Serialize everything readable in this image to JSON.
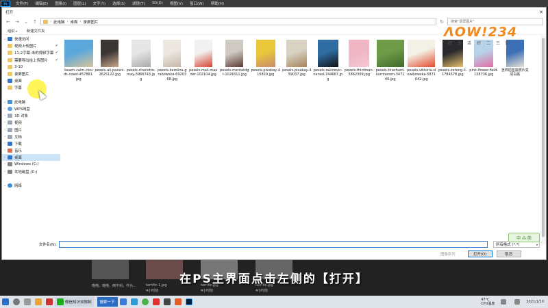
{
  "ps_menu": {
    "logo": "Ps",
    "items": [
      "文件(F)",
      "编辑(E)",
      "图像(I)",
      "图层(L)",
      "文字(Y)",
      "选择(S)",
      "滤镜(T)",
      "3D(D)",
      "视图(V)",
      "窗口(W)",
      "帮助(H)"
    ]
  },
  "dialog": {
    "title": "打开",
    "close": "✕",
    "breadcrumb": [
      "此电脑",
      "桌面",
      "录屏图片"
    ],
    "search_placeholder": "搜索\"录屏图片\"",
    "cmd": {
      "organize": "组织",
      "new_folder": "新建文件夹"
    }
  },
  "nav": {
    "items": [
      {
        "label": "快速访问",
        "icon": "star-icon",
        "kind": "header"
      },
      {
        "label": "视频上传图片",
        "icon": "folder-icon",
        "pin": "✔"
      },
      {
        "label": "11-2字幕-未的视频字幕",
        "icon": "folder-icon",
        "pin": "✔"
      },
      {
        "label": "需要导出给上传图片",
        "icon": "folder-icon",
        "pin": "✔"
      },
      {
        "label": "3-10",
        "icon": "folder-icon"
      },
      {
        "label": "录屏图片",
        "icon": "folder-icon"
      },
      {
        "label": "桌面",
        "icon": "desktop-icon"
      },
      {
        "label": "字幕",
        "icon": "folder-icon"
      },
      {
        "label": "",
        "icon": "",
        "kind": "spacer"
      },
      {
        "label": "此电脑",
        "icon": "pc-icon",
        "kind": "header"
      },
      {
        "label": "WPS网盘",
        "icon": "cloud-icon"
      },
      {
        "label": "3D 对象",
        "icon": "cube-icon"
      },
      {
        "label": "视频",
        "icon": "video-icon"
      },
      {
        "label": "图片",
        "icon": "pictures-icon"
      },
      {
        "label": "文档",
        "icon": "documents-icon"
      },
      {
        "label": "下载",
        "icon": "download-icon"
      },
      {
        "label": "音乐",
        "icon": "music-icon"
      },
      {
        "label": "桌面",
        "icon": "desktop-icon",
        "selected": true
      },
      {
        "label": "Windows (C:)",
        "icon": "drive-icon"
      },
      {
        "label": "本地磁盘 (D:)",
        "icon": "drive-icon"
      },
      {
        "label": "",
        "icon": "",
        "kind": "spacer"
      },
      {
        "label": "网络",
        "icon": "network-icon",
        "kind": "header"
      }
    ]
  },
  "files": [
    {
      "name": "beach-calm-clouds-coast-457881.jpg",
      "c1": "#5aa7dc",
      "c2": "#d9c59a"
    },
    {
      "name": "pexels-ali-pazani-2625122.jpg",
      "c1": "#3b3534",
      "c2": "#c9a58c"
    },
    {
      "name": "pexels-charlotte-may-5966743.jpg",
      "c1": "#e6e6e6",
      "c2": "#a9a9a9"
    },
    {
      "name": "pexels-karolina-grabowska-6920368.jpg",
      "c1": "#ece7e1",
      "c2": "#c7b7a6"
    },
    {
      "name": "pexels-mali-maeder-102104.jpg",
      "c1": "#f1f1f1",
      "c2": "#d8412f"
    },
    {
      "name": "pexels-mentatdgt-1024311.jpg",
      "c1": "#cfcac3",
      "c2": "#5a3b30"
    },
    {
      "name": "pexels-pixabay-415829.jpg",
      "c1": "#e8c83a",
      "c2": "#c98b6b"
    },
    {
      "name": "pexels-pixabay-459037.jpg",
      "c1": "#d8d2c3",
      "c2": "#a7835a"
    },
    {
      "name": "pexels-rakicevic-nenad-744667.jpg",
      "c1": "#2f6da3",
      "c2": "#111111"
    },
    {
      "name": "pexels-thirdman-5862309.jpg",
      "c1": "#f0b6c4",
      "c2": "#f3c8d2"
    },
    {
      "name": "pexels-tirachard-kumtanom-347140.jpg",
      "c1": "#6f9b48",
      "c2": "#3d6a2c"
    },
    {
      "name": "pexels-viktoria-slowikowska-5871642.jpg",
      "c1": "#f3f0e6",
      "c2": "#e24b2b"
    },
    {
      "name": "pexels-zetong-li-1784578.jpg",
      "c1": "#2a2a2e",
      "c2": "#e9c26a"
    },
    {
      "name": "pink-flower-field-158736.jpg",
      "c1": "#b7d3ea",
      "c2": "#e26da4"
    },
    {
      "name": "怎样把蓝底照片变成白底",
      "c1": "#3c6fb5",
      "c2": "#e9e1d4"
    }
  ],
  "bottom": {
    "filename_label": "文件名(N):",
    "filename_value": "",
    "filetype": "所有格式 (*.*)",
    "image_sequence": "图像序列",
    "open": "打开(O)",
    "cancel": "取消"
  },
  "logo": {
    "main": "ᐱOW!234",
    "sub": "好生活好二三四"
  },
  "badge": "中 ⁂ 简",
  "subtitle": "在PS主界面点击左侧的【打开】",
  "background_captions": [
    {
      "text": "啪啪，啪啪，倒不利，作为...",
      "sub": ""
    },
    {
      "text": "terrific-1.jpg",
      "sub": "4小时前"
    },
    {
      "text": "terrific.jpg",
      "sub": "4小时前"
    },
    {
      "text": "terrific.jpg",
      "sub": "4小时前"
    }
  ],
  "taskbar": {
    "task1": "微信知识双限制",
    "search": "搜索一下",
    "weather_temp": "47°C",
    "weather_label": "CPU温度",
    "time": "",
    "date": "2021/1/10"
  }
}
